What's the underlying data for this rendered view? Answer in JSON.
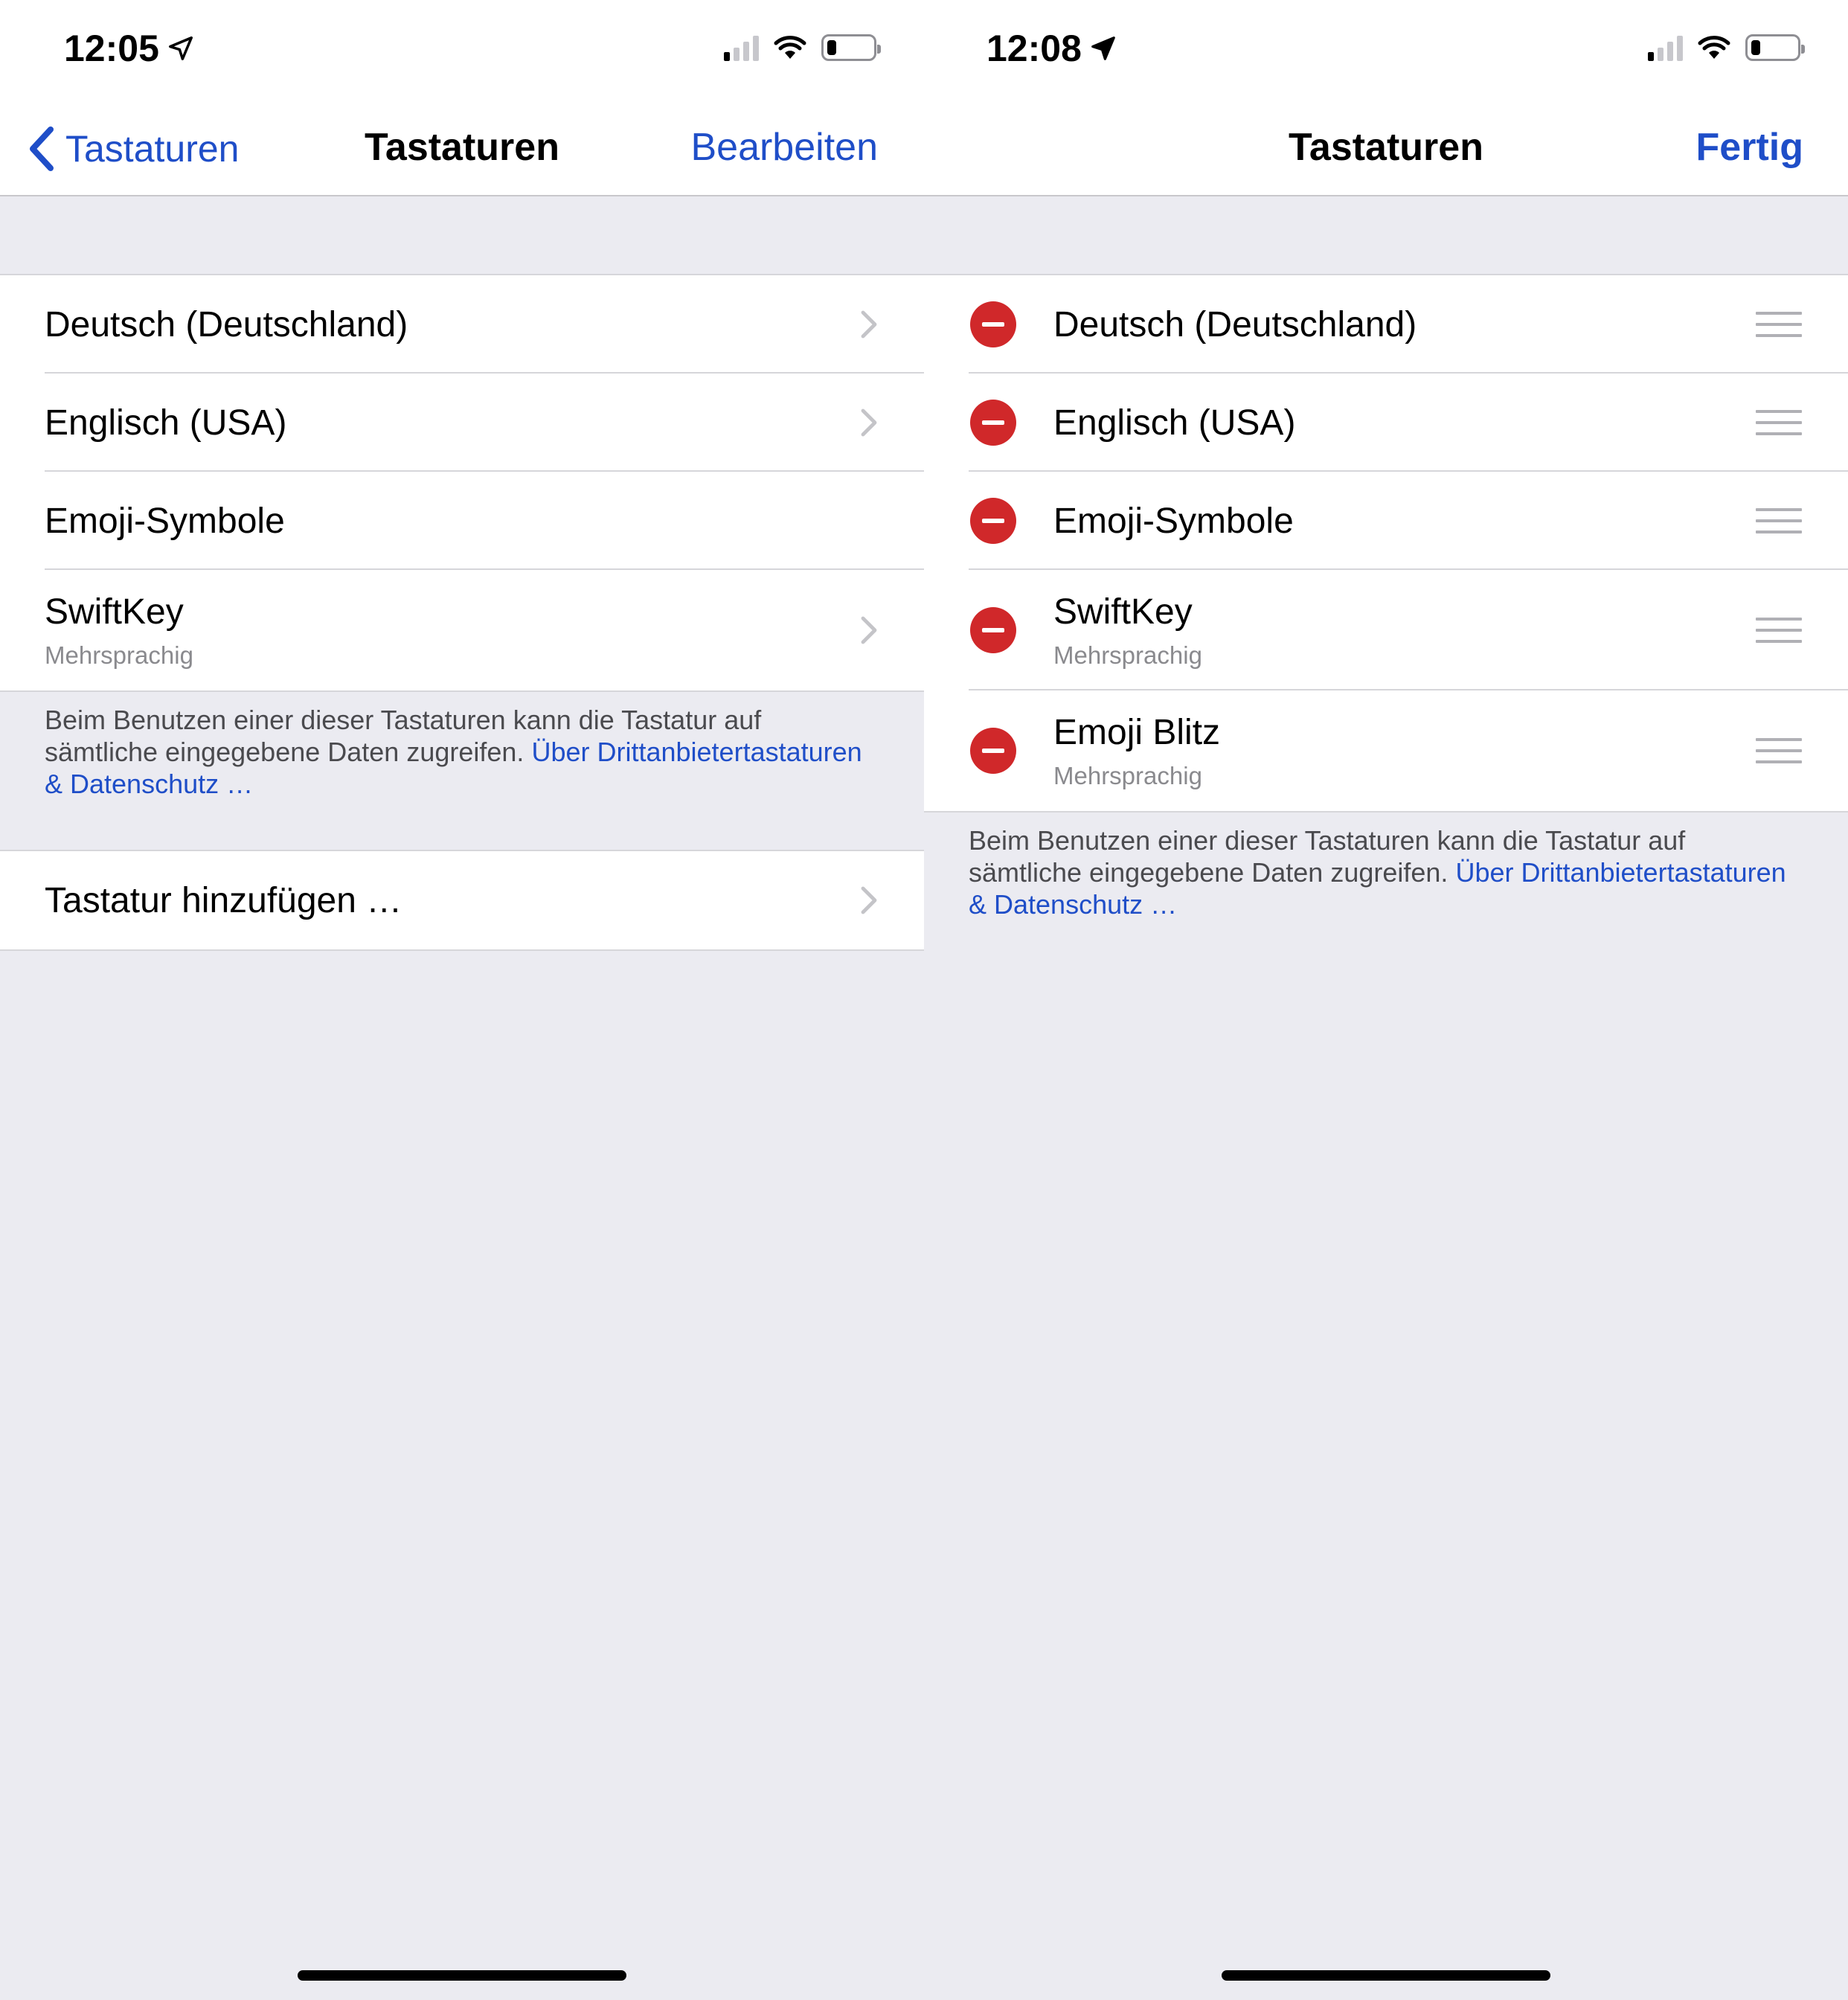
{
  "left": {
    "status": {
      "time": "12:05"
    },
    "nav": {
      "back_label": "Tastaturen",
      "title": "Tastaturen",
      "action_label": "Bearbeiten"
    },
    "keyboards": [
      {
        "label": "Deutsch (Deutschland)"
      },
      {
        "label": "Englisch (USA)"
      },
      {
        "label": "Emoji-Symbole"
      },
      {
        "label": "SwiftKey",
        "sub": "Mehrsprachig"
      }
    ],
    "footer": {
      "text": "Beim Benutzen einer dieser Tastaturen kann die Tastatur auf sämtliche eingegebene Daten zugreifen.",
      "link": "Über Drittanbietertastaturen & Datenschutz …"
    },
    "add_keyboard_label": "Tastatur hinzufügen …"
  },
  "right": {
    "status": {
      "time": "12:08"
    },
    "nav": {
      "title": "Tastaturen",
      "action_label": "Fertig"
    },
    "keyboards": [
      {
        "label": "Deutsch (Deutschland)"
      },
      {
        "label": "Englisch (USA)"
      },
      {
        "label": "Emoji-Symbole"
      },
      {
        "label": "SwiftKey",
        "sub": "Mehrsprachig"
      },
      {
        "label": "Emoji Blitz",
        "sub": "Mehrsprachig"
      }
    ],
    "footer": {
      "text": "Beim Benutzen einer dieser Tastaturen kann die Tastatur auf sämtliche eingegebene Daten zugreifen.",
      "link": "Über Drittanbietertastaturen & Datenschutz …"
    }
  },
  "colors": {
    "accent": "#1f4ec8",
    "delete": "#d0282a",
    "background": "#ebebf1"
  }
}
